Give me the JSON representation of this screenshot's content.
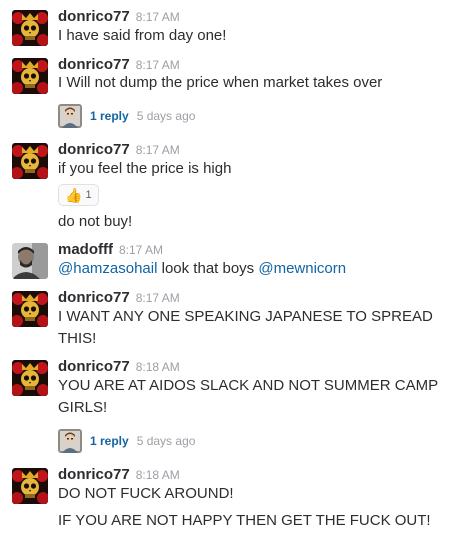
{
  "messages": [
    {
      "author": "donrico77",
      "time": "8:17 AM",
      "avatar": "skull-rose-avatar",
      "lines": [
        "I have said from day one!"
      ]
    },
    {
      "author": "donrico77",
      "time": "8:17 AM",
      "avatar": "skull-rose-avatar",
      "lines": [
        "I Will not dump the price when market takes over"
      ],
      "thread": {
        "replies": "1 reply",
        "when": "5 days ago"
      }
    },
    {
      "author": "donrico77",
      "time": "8:17 AM",
      "avatar": "skull-rose-avatar",
      "lines": [
        "if you feel the price is high",
        "do not buy!"
      ],
      "reaction": {
        "emoji": "thumbs-up-icon",
        "count": "1"
      }
    },
    {
      "author": "madofff",
      "time": "8:17 AM",
      "avatar": "photo-avatar",
      "mention1": "@hamzasohail",
      "middle": " look that boys ",
      "mention2": "@mewnicorn"
    },
    {
      "author": "donrico77",
      "time": "8:17 AM",
      "avatar": "skull-rose-avatar",
      "lines": [
        "I WANT ANY ONE SPEAKING JAPANESE TO SPREAD",
        "THIS!"
      ]
    },
    {
      "author": "donrico77",
      "time": "8:18 AM",
      "avatar": "skull-rose-avatar",
      "lines": [
        "YOU ARE AT AIDOS SLACK AND NOT SUMMER CAMP",
        "GIRLS!"
      ],
      "thread": {
        "replies": "1 reply",
        "when": "5 days ago"
      }
    },
    {
      "author": "donrico77",
      "time": "8:18 AM",
      "avatar": "skull-rose-avatar",
      "lines": [
        "DO NOT FUCK AROUND!",
        "IF YOU ARE NOT HAPPY THEN GET THE FUCK OUT!"
      ]
    }
  ],
  "colors": {
    "link": "#1264a3",
    "timestamp": "#9e9ea6",
    "text": "#2c2d30"
  }
}
